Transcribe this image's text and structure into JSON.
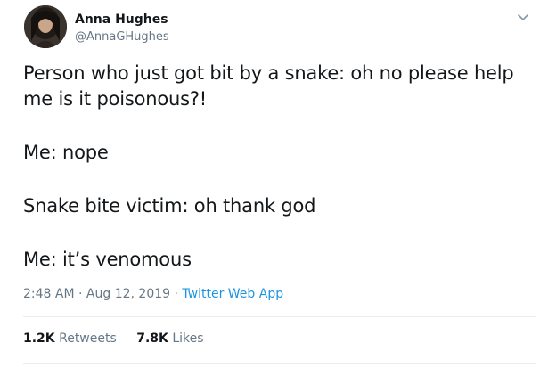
{
  "user": {
    "name": "Anna Hughes",
    "handle": "@AnnaGHughes"
  },
  "tweet": {
    "lines": [
      [
        "Person who just got bit by a snake:  oh no please help",
        "me is it poisonous?!"
      ],
      [
        "Me: nope"
      ],
      [
        "Snake bite victim: oh thank god"
      ],
      [
        "Me: it’s venomous"
      ]
    ]
  },
  "meta": {
    "time": "2:48 AM",
    "sep1": " · ",
    "date": "Aug 12, 2019",
    "sep2": " · ",
    "source": "Twitter Web App"
  },
  "stats": {
    "retweets_count": "1.2K",
    "retweets_label": "Retweets",
    "likes_count": "7.8K",
    "likes_label": "Likes"
  },
  "icons": {
    "menu": "chevron-down-icon",
    "avatar": "avatar"
  },
  "colors": {
    "text": "#14171a",
    "secondary": "#657786",
    "link": "#1b95e0",
    "divider": "#e6ecf0"
  }
}
